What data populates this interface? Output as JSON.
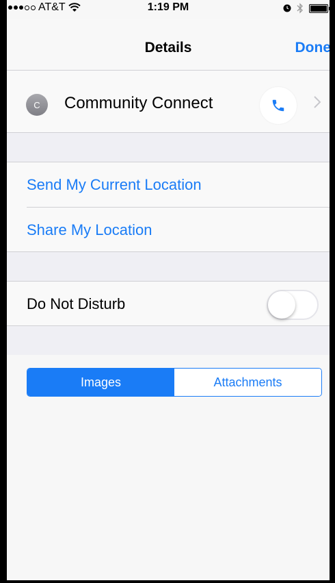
{
  "status_bar": {
    "carrier": "AT&T",
    "time": "1:19 PM"
  },
  "nav": {
    "title": "Details",
    "done_label": "Done"
  },
  "contact": {
    "initial": "C",
    "name": "Community Connect"
  },
  "location": {
    "send_current": "Send My Current Location",
    "share": "Share My Location"
  },
  "dnd": {
    "label": "Do Not Disturb",
    "enabled": false
  },
  "segments": {
    "items": [
      "Images",
      "Attachments"
    ],
    "selected": "Images"
  },
  "colors": {
    "accent": "#1a7cf6",
    "background": "#f7f7f7",
    "group_gap": "#efeff4"
  }
}
